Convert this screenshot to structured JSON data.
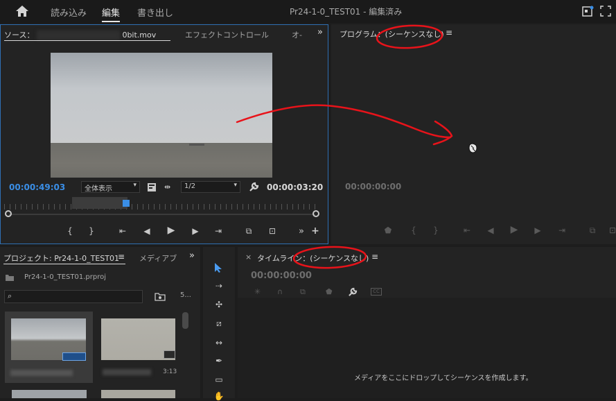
{
  "topbar": {
    "home_icon": "home-icon",
    "tabs": [
      {
        "label": "読み込み",
        "active": false
      },
      {
        "label": "編集",
        "active": true
      },
      {
        "label": "書き出し",
        "active": false
      }
    ],
    "project_title": "Pr24-1-0_TEST01 - 編集済み"
  },
  "source_panel": {
    "tab_source_prefix": "ソース：",
    "tab_source_clip_suffix": "0bit.mov",
    "tab_effect_controls": "エフェクトコントロール",
    "tab_overflow": "オ-",
    "expand_label": "»",
    "timecode_current": "00:00:49:03",
    "fit_dropdown": "全体表示",
    "resolution_dropdown": "1/2",
    "timecode_duration": "00:00:03:20",
    "play_label": "▶",
    "more_label": "»",
    "add_label": "+"
  },
  "program_panel": {
    "title": "プログラム：(シーケンスなし)",
    "menu_label": "≡",
    "timecode": "00:00:00:00"
  },
  "project_panel": {
    "tab_project": "プロジェクト: Pr24-1-0_TEST01",
    "menu_label": "≡",
    "tab_media": "メディアブ",
    "expand_label": "»",
    "file_name": "Pr24-1-0_TEST01.prproj",
    "items_count": "5...",
    "thumbnail_duration": "3:13"
  },
  "timeline_panel": {
    "close_label": "×",
    "title": "タイムライン：(シーケンスなし)",
    "menu_label": "≡",
    "timecode": "00:00:00:00",
    "empty_message": "メディアをここにドロップしてシーケンスを作成します。"
  },
  "colors": {
    "accent_blue": "#3a8ee6",
    "annotation_red": "#e8131a",
    "panel_bg": "#232323"
  }
}
